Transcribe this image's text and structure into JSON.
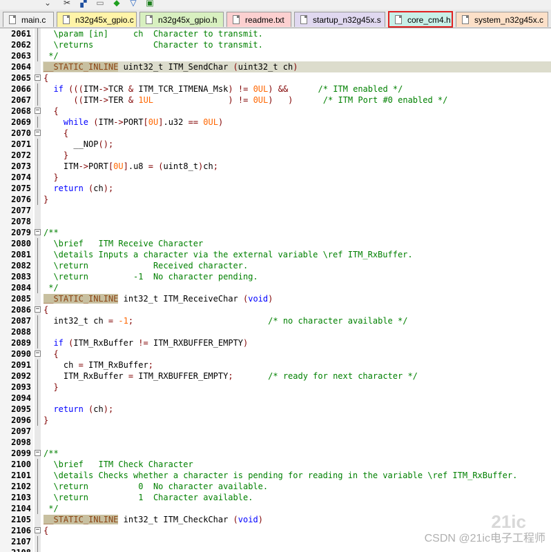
{
  "tabs": [
    {
      "label": "main.c",
      "color": "#f0f0f0"
    },
    {
      "label": "n32g45x_gpio.c",
      "color": "#fff4a8"
    },
    {
      "label": "n32g45x_gpio.h",
      "color": "#d8f0c0"
    },
    {
      "label": "readme.txt",
      "color": "#fcd0d0"
    },
    {
      "label": "startup_n32g45x.s",
      "color": "#e0d8f0"
    },
    {
      "label": "core_cm4.h",
      "color": "#c8f0e8",
      "active": true
    },
    {
      "label": "system_n32g45x.c",
      "color": "#fce0c8"
    }
  ],
  "colors": {
    "comment": "#008000",
    "keyword": "#0000ff",
    "number": "#ff6600",
    "operator": "#800000",
    "highlight": "#dcdccc",
    "active_tab_border": "#e02020"
  },
  "editor": {
    "lines": [
      {
        "num": "2061",
        "fold": "line",
        "text": "  \\param [in]     ch  Character to transmit."
      },
      {
        "num": "2062",
        "fold": "line",
        "text": "  \\returns            Character to transmit."
      },
      {
        "num": "2063",
        "fold": "line",
        "text": " */"
      },
      {
        "num": "2064",
        "fold": "",
        "text": "__STATIC_INLINE uint32_t ITM_SendChar (uint32_t ch)",
        "hl": true
      },
      {
        "num": "2065",
        "fold": "minus",
        "text": "{"
      },
      {
        "num": "2066",
        "fold": "line",
        "text": "  if (((ITM->TCR & ITM_TCR_ITMENA_Msk) != 0UL) &&      /* ITM enabled */"
      },
      {
        "num": "2067",
        "fold": "line",
        "text": "      ((ITM->TER & 1UL               ) != 0UL)   )      /* ITM Port #0 enabled */"
      },
      {
        "num": "2068",
        "fold": "minus",
        "text": "  {"
      },
      {
        "num": "2069",
        "fold": "line",
        "text": "    while (ITM->PORT[0U].u32 == 0UL)"
      },
      {
        "num": "2070",
        "fold": "minus",
        "text": "    {"
      },
      {
        "num": "2071",
        "fold": "line",
        "text": "      __NOP();"
      },
      {
        "num": "2072",
        "fold": "line",
        "text": "    }"
      },
      {
        "num": "2073",
        "fold": "line",
        "text": "    ITM->PORT[0U].u8 = (uint8_t)ch;"
      },
      {
        "num": "2074",
        "fold": "line",
        "text": "  }"
      },
      {
        "num": "2075",
        "fold": "line",
        "text": "  return (ch);"
      },
      {
        "num": "2076",
        "fold": "line",
        "text": "}"
      },
      {
        "num": "2077",
        "fold": "",
        "text": ""
      },
      {
        "num": "2078",
        "fold": "",
        "text": ""
      },
      {
        "num": "2079",
        "fold": "minus",
        "text": "/**"
      },
      {
        "num": "2080",
        "fold": "line",
        "text": "  \\brief   ITM Receive Character"
      },
      {
        "num": "2081",
        "fold": "line",
        "text": "  \\details Inputs a character via the external variable \\ref ITM_RxBuffer."
      },
      {
        "num": "2082",
        "fold": "line",
        "text": "  \\return             Received character."
      },
      {
        "num": "2083",
        "fold": "line",
        "text": "  \\return         -1  No character pending."
      },
      {
        "num": "2084",
        "fold": "line",
        "text": " */"
      },
      {
        "num": "2085",
        "fold": "",
        "text": "__STATIC_INLINE int32_t ITM_ReceiveChar (void)"
      },
      {
        "num": "2086",
        "fold": "minus",
        "text": "{"
      },
      {
        "num": "2087",
        "fold": "line",
        "text": "  int32_t ch = -1;                           /* no character available */"
      },
      {
        "num": "2088",
        "fold": "line",
        "text": ""
      },
      {
        "num": "2089",
        "fold": "line",
        "text": "  if (ITM_RxBuffer != ITM_RXBUFFER_EMPTY)"
      },
      {
        "num": "2090",
        "fold": "minus",
        "text": "  {"
      },
      {
        "num": "2091",
        "fold": "line",
        "text": "    ch = ITM_RxBuffer;"
      },
      {
        "num": "2092",
        "fold": "line",
        "text": "    ITM_RxBuffer = ITM_RXBUFFER_EMPTY;       /* ready for next character */"
      },
      {
        "num": "2093",
        "fold": "line",
        "text": "  }"
      },
      {
        "num": "2094",
        "fold": "line",
        "text": ""
      },
      {
        "num": "2095",
        "fold": "line",
        "text": "  return (ch);"
      },
      {
        "num": "2096",
        "fold": "line",
        "text": "}"
      },
      {
        "num": "2097",
        "fold": "",
        "text": ""
      },
      {
        "num": "2098",
        "fold": "",
        "text": ""
      },
      {
        "num": "2099",
        "fold": "minus",
        "text": "/**"
      },
      {
        "num": "2100",
        "fold": "line",
        "text": "  \\brief   ITM Check Character"
      },
      {
        "num": "2101",
        "fold": "line",
        "text": "  \\details Checks whether a character is pending for reading in the variable \\ref ITM_RxBuffer."
      },
      {
        "num": "2102",
        "fold": "line",
        "text": "  \\return          0  No character available."
      },
      {
        "num": "2103",
        "fold": "line",
        "text": "  \\return          1  Character available."
      },
      {
        "num": "2104",
        "fold": "line",
        "text": " */"
      },
      {
        "num": "2105",
        "fold": "",
        "text": "__STATIC_INLINE int32_t ITM_CheckChar (void)"
      },
      {
        "num": "2106",
        "fold": "minus",
        "text": "{"
      },
      {
        "num": "2107",
        "fold": "line",
        "text": ""
      },
      {
        "num": "2108",
        "fold": "line",
        "text": ""
      }
    ]
  },
  "watermark": {
    "text": "CSDN @21ic电子工程师",
    "logo": "21ic"
  }
}
